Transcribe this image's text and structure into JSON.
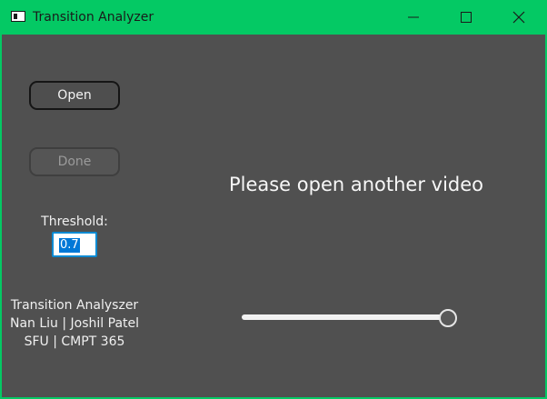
{
  "window": {
    "title": "Transition Analyzer",
    "accent_color": "#04c964",
    "background_color": "#505050"
  },
  "controls": {
    "open_label": "Open",
    "done_label": "Done",
    "done_enabled": false,
    "threshold_label": "Threshold:",
    "threshold_value": "0.7"
  },
  "credits": {
    "line1": "Transition Analyszer",
    "line2": "Nan Liu | Joshil Patel",
    "line3": "SFU | CMPT 365"
  },
  "main": {
    "message": "Please open another video",
    "slider_level": 1.0
  },
  "icons": {
    "app": "app-window-icon",
    "minimize": "minimize-icon",
    "maximize": "maximize-icon",
    "close": "close-icon"
  }
}
